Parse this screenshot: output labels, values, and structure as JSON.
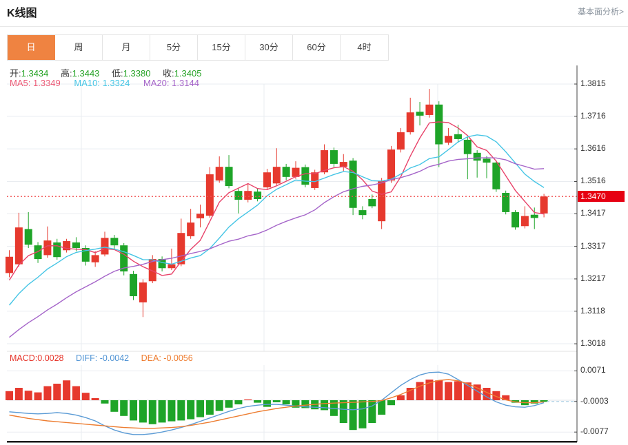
{
  "header": {
    "title": "K线图",
    "link": "基本面分析>"
  },
  "tabs": {
    "items": [
      "日",
      "周",
      "月",
      "5分",
      "15分",
      "30分",
      "60分",
      "4时"
    ],
    "active_index": 0
  },
  "quote": {
    "open_label": "开:",
    "open": "1.3434",
    "high_label": "高:",
    "high": "1.3443",
    "low_label": "低:",
    "low": "1.3380",
    "close_label": "收:",
    "close": "1.3405"
  },
  "ma_header": {
    "ma5_label": "MA5:",
    "ma5": "1.3349",
    "ma10_label": "MA10:",
    "ma10": "1.3324",
    "ma20_label": "MA20:",
    "ma20": "1.3144"
  },
  "macd_header": {
    "macd_label": "MACD:",
    "macd": "0.0028",
    "diff_label": "DIFF:",
    "diff": "-0.0042",
    "dea_label": "DEA:",
    "dea": "-0.0056"
  },
  "price_badge": "1.3470",
  "colors": {
    "bull_red": "#e6392e",
    "bear_green": "#1ea428",
    "ma5_line": "#e8436a",
    "ma10_line": "#45c5e5",
    "ma20_line": "#a565c9",
    "diff_line": "#5b9bd5",
    "dea_line": "#ed7d31",
    "latest_price_line": "#f05050",
    "badge_bg": "#e60012",
    "grid": "#e9ecf0",
    "axis": "#444444",
    "dashed_ext": "#9fc8e0",
    "tab_active_bg": "#ef8341",
    "quote_green": "#27a327"
  },
  "chart_data": {
    "type": "candlestick+macd",
    "title": "K线图",
    "legend": [
      "MA5",
      "MA10",
      "MA20",
      "MACD",
      "DIFF",
      "DEA"
    ],
    "price_axis_labels": [
      "1.3815",
      "1.3716",
      "1.3616",
      "1.3516",
      "1.3417",
      "1.3317",
      "1.3217",
      "1.3118",
      "1.3018"
    ],
    "price_axis_values": [
      1.3815,
      1.3716,
      1.3616,
      1.3516,
      1.3417,
      1.3317,
      1.3217,
      1.3118,
      1.3018
    ],
    "macd_axis_labels": [
      "0.0071",
      "-0.0003",
      "-0.0077"
    ],
    "macd_axis_values": [
      0.0071,
      -0.0003,
      -0.0077
    ],
    "latest_price": 1.347,
    "candles_ohlc_note": "each candle is [open, high, low, close]; red=up green=down",
    "candles": [
      [
        1.3235,
        1.3305,
        1.3222,
        1.3285
      ],
      [
        1.3262,
        1.342,
        1.3255,
        1.3375
      ],
      [
        1.337,
        1.3422,
        1.3312,
        1.3322
      ],
      [
        1.332,
        1.333,
        1.3266,
        1.3278
      ],
      [
        1.329,
        1.3378,
        1.3282,
        1.3335
      ],
      [
        1.3329,
        1.334,
        1.3276,
        1.3284
      ],
      [
        1.3305,
        1.334,
        1.3298,
        1.3333
      ],
      [
        1.3329,
        1.3345,
        1.3302,
        1.3312
      ],
      [
        1.3312,
        1.332,
        1.3258,
        1.327
      ],
      [
        1.3268,
        1.3302,
        1.3254,
        1.329
      ],
      [
        1.3292,
        1.3362,
        1.3286,
        1.3343
      ],
      [
        1.3343,
        1.3352,
        1.3308,
        1.332
      ],
      [
        1.332,
        1.3327,
        1.3228,
        1.324
      ],
      [
        1.3232,
        1.3242,
        1.3152,
        1.3164
      ],
      [
        1.3145,
        1.3216,
        1.31,
        1.3206
      ],
      [
        1.321,
        1.329,
        1.3204,
        1.3278
      ],
      [
        1.3278,
        1.3286,
        1.324,
        1.325
      ],
      [
        1.325,
        1.331,
        1.3244,
        1.3262
      ],
      [
        1.3262,
        1.3402,
        1.3256,
        1.3358
      ],
      [
        1.3348,
        1.3432,
        1.334,
        1.339
      ],
      [
        1.3403,
        1.3445,
        1.3375,
        1.3417
      ],
      [
        1.3411,
        1.356,
        1.3405,
        1.3538
      ],
      [
        1.3519,
        1.3593,
        1.3512,
        1.3561
      ],
      [
        1.3561,
        1.3597,
        1.3495,
        1.3502
      ],
      [
        1.3487,
        1.3495,
        1.3418,
        1.346
      ],
      [
        1.346,
        1.3508,
        1.3452,
        1.3487
      ],
      [
        1.3485,
        1.3495,
        1.3455,
        1.3462
      ],
      [
        1.3498,
        1.3555,
        1.349,
        1.3544
      ],
      [
        1.351,
        1.3618,
        1.3505,
        1.3561
      ],
      [
        1.3561,
        1.357,
        1.352,
        1.353
      ],
      [
        1.353,
        1.3578,
        1.3524,
        1.3558
      ],
      [
        1.356,
        1.3568,
        1.3498,
        1.3506
      ],
      [
        1.3496,
        1.3552,
        1.349,
        1.3544
      ],
      [
        1.3544,
        1.363,
        1.3538,
        1.3612
      ],
      [
        1.3612,
        1.362,
        1.356,
        1.357
      ],
      [
        1.3561,
        1.36,
        1.3548,
        1.3576
      ],
      [
        1.358,
        1.3588,
        1.3413,
        1.3435
      ],
      [
        1.3428,
        1.344,
        1.34,
        1.3413
      ],
      [
        1.3462,
        1.3476,
        1.3434,
        1.344
      ],
      [
        1.3394,
        1.3527,
        1.337,
        1.3519
      ],
      [
        1.3519,
        1.3625,
        1.3512,
        1.3614
      ],
      [
        1.3614,
        1.368,
        1.3605,
        1.3667
      ],
      [
        1.3667,
        1.3773,
        1.366,
        1.3728
      ],
      [
        1.373,
        1.376,
        1.3688,
        1.3718
      ],
      [
        1.372,
        1.38,
        1.3712,
        1.3752
      ],
      [
        1.3752,
        1.3762,
        1.356,
        1.363
      ],
      [
        1.3635,
        1.368,
        1.3628,
        1.3656
      ],
      [
        1.3661,
        1.369,
        1.3635,
        1.3646
      ],
      [
        1.3644,
        1.3652,
        1.3523,
        1.36
      ],
      [
        1.3604,
        1.3612,
        1.3528,
        1.358
      ],
      [
        1.3586,
        1.3594,
        1.3526,
        1.3574
      ],
      [
        1.3574,
        1.358,
        1.3484,
        1.3492
      ],
      [
        1.3481,
        1.3488,
        1.3415,
        1.3422
      ],
      [
        1.3422,
        1.3428,
        1.3368,
        1.3375
      ],
      [
        1.3379,
        1.344,
        1.3372,
        1.341
      ],
      [
        1.3414,
        1.3436,
        1.337,
        1.3404
      ],
      [
        1.3418,
        1.3478,
        1.3406,
        1.347
      ]
    ],
    "prehistory_closes": [
      1.289,
      1.2895,
      1.29,
      1.291,
      1.292,
      1.293,
      1.294,
      1.295,
      1.2965,
      1.298,
      1.3,
      1.302,
      1.304,
      1.306,
      1.308,
      1.31,
      1.314,
      1.318,
      1.3215,
      1.3245
    ],
    "ma_periods": [
      5,
      10,
      20
    ],
    "macd_hist": [
      0.0022,
      0.003,
      0.0023,
      0.0019,
      0.0034,
      0.004,
      0.0048,
      0.0034,
      0.0018,
      0.0005,
      -0.0008,
      -0.0028,
      -0.0038,
      -0.0049,
      -0.0054,
      -0.0058,
      -0.0054,
      -0.0051,
      -0.0049,
      -0.0046,
      -0.0041,
      -0.0035,
      -0.0026,
      -0.0018,
      -0.001,
      0.0002,
      -0.0006,
      -0.0016,
      -0.0005,
      -0.001,
      -0.0018,
      -0.0019,
      -0.0022,
      -0.0024,
      -0.0038,
      -0.0055,
      -0.0072,
      -0.0068,
      -0.0055,
      -0.0035,
      -0.0012,
      0.0012,
      0.003,
      0.0044,
      0.005,
      0.0048,
      0.0044,
      0.0046,
      0.0043,
      0.0038,
      0.003,
      0.0022,
      0.0012,
      -0.0006,
      -0.0012,
      -0.0008,
      -0.0004
    ],
    "diff_line": [
      -0.0028,
      -0.003,
      -0.0032,
      -0.0033,
      -0.0032,
      -0.003,
      -0.0032,
      -0.0036,
      -0.0042,
      -0.005,
      -0.0062,
      -0.0072,
      -0.0079,
      -0.0083,
      -0.0083,
      -0.0081,
      -0.0077,
      -0.0072,
      -0.0066,
      -0.0059,
      -0.0051,
      -0.0043,
      -0.0035,
      -0.0027,
      -0.002,
      -0.0015,
      -0.0012,
      -0.001,
      -0.001,
      -0.0012,
      -0.0014,
      -0.0016,
      -0.0017,
      -0.0018,
      -0.002,
      -0.0022,
      -0.0023,
      -0.0021,
      -0.0014,
      0.0,
      0.0018,
      0.0036,
      0.005,
      0.0061,
      0.0067,
      0.0068,
      0.0063,
      0.005,
      0.0036,
      0.0022,
      0.0008,
      -0.0004,
      -0.0012,
      -0.0016,
      -0.0017,
      -0.0013,
      -0.0006
    ],
    "dea_line": [
      -0.0036,
      -0.004,
      -0.0044,
      -0.0047,
      -0.005,
      -0.0052,
      -0.0054,
      -0.0056,
      -0.0058,
      -0.006,
      -0.0062,
      -0.0064,
      -0.0066,
      -0.0067,
      -0.0068,
      -0.0068,
      -0.0067,
      -0.0066,
      -0.0064,
      -0.0061,
      -0.0057,
      -0.0053,
      -0.0048,
      -0.0043,
      -0.0038,
      -0.0033,
      -0.0028,
      -0.0024,
      -0.002,
      -0.0017,
      -0.0014,
      -0.0012,
      -0.001,
      -0.0008,
      -0.0007,
      -0.0006,
      -0.0005,
      -0.0004,
      -0.0003,
      -0.0001,
      0.0006,
      0.0014,
      0.0024,
      0.0034,
      0.0042,
      0.0048,
      0.005,
      0.0047,
      0.004,
      0.003,
      0.0019,
      0.0009,
      0.0001,
      -0.0004,
      -0.0006,
      -0.0006,
      -0.0004
    ]
  }
}
